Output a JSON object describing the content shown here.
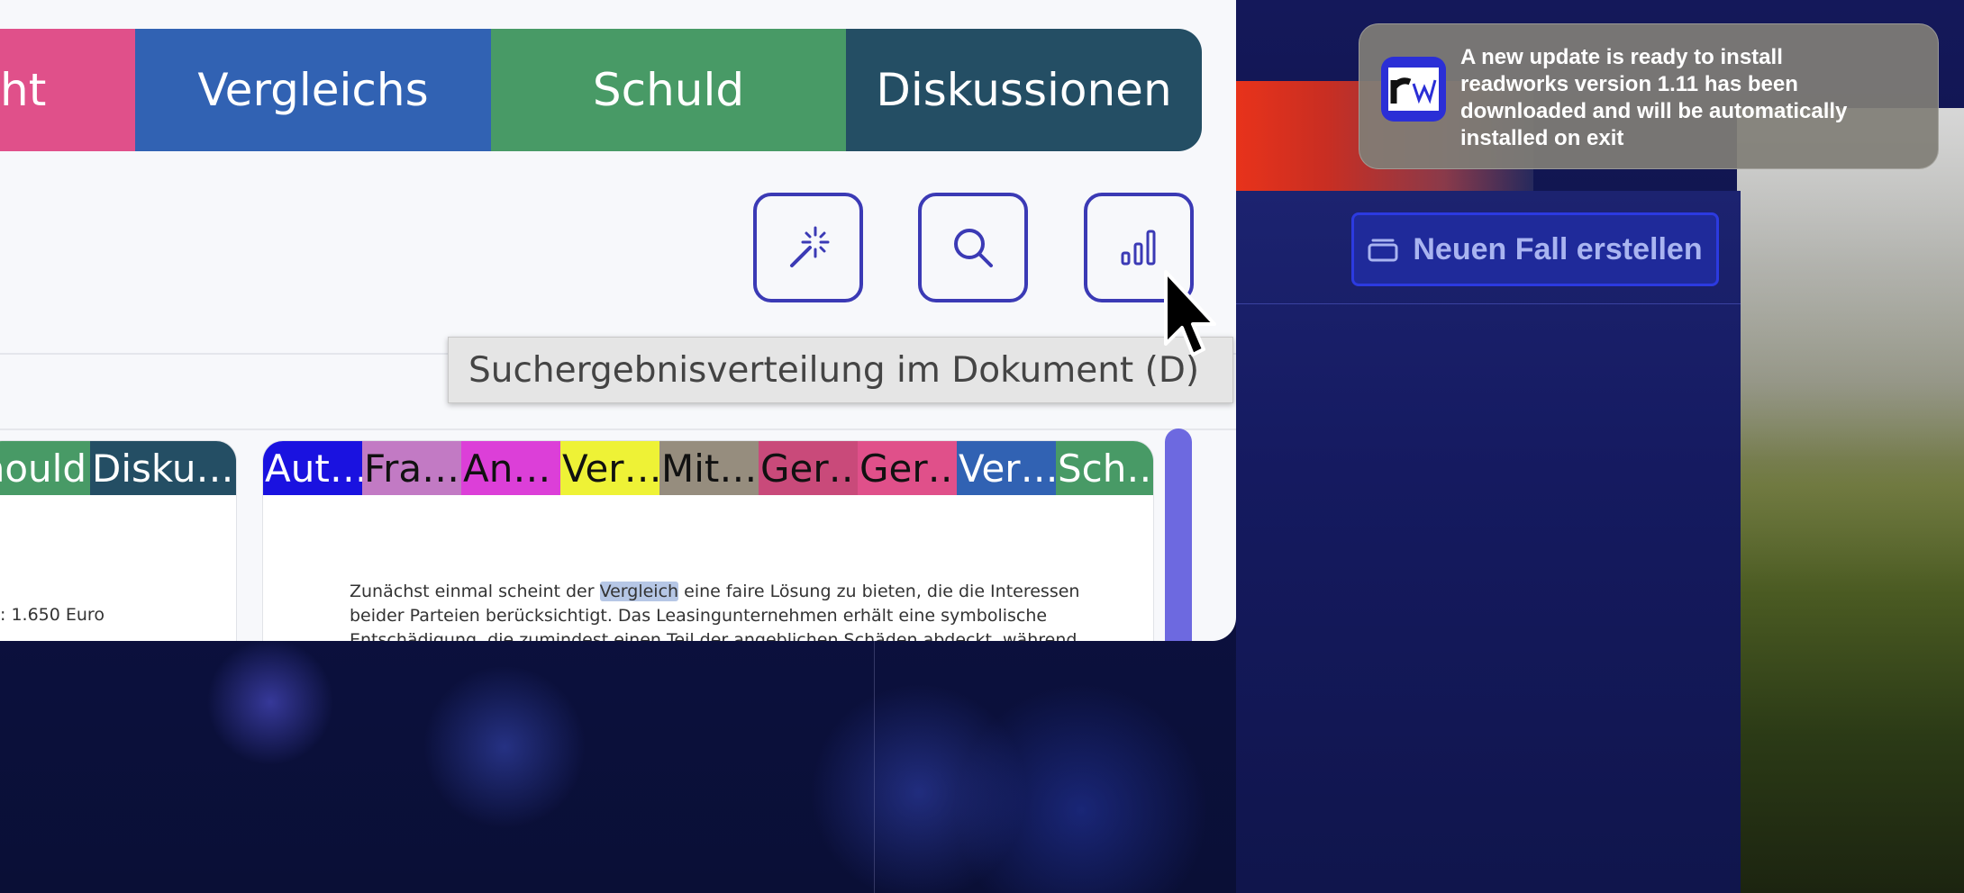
{
  "app": {
    "tabs": [
      {
        "label": "ht",
        "color": "#e0508a"
      },
      {
        "label": "Vergleichs",
        "color": "#3162b3"
      },
      {
        "label": "Schuld",
        "color": "#489a66"
      },
      {
        "label": "Diskussionen",
        "color": "#244e64"
      }
    ],
    "toolbar": {
      "buttons": [
        {
          "name": "magic-wand",
          "icon": "magic-wand-icon"
        },
        {
          "name": "search",
          "icon": "search-icon"
        },
        {
          "name": "distribution",
          "icon": "bar-chart-icon"
        }
      ],
      "tooltip": "Suchergebnisverteilung im Dokument (D)"
    },
    "left_card": {
      "chips": [
        {
          "label": "hould",
          "color": "#489a66"
        },
        {
          "label": "Disku…",
          "color": "#244e64"
        }
      ],
      "text": ": 1.650 Euro"
    },
    "right_card": {
      "chips": [
        {
          "label": "Aut…",
          "color": "#1a12e0",
          "text_color": "#ffffff"
        },
        {
          "label": "Fra…",
          "color": "#c27ac4",
          "text_color": "#111111"
        },
        {
          "label": "An…",
          "color": "#dc3fd8",
          "text_color": "#111111"
        },
        {
          "label": "Ver…",
          "color": "#eef236",
          "text_color": "#111111"
        },
        {
          "label": "Mit…",
          "color": "#968d7e",
          "text_color": "#111111"
        },
        {
          "label": "Ger…",
          "color": "#c94a7a",
          "text_color": "#111111"
        },
        {
          "label": "Ger…",
          "color": "#e0508a",
          "text_color": "#ffffff"
        },
        {
          "label": "Ver…",
          "color": "#3162b3",
          "text_color": "#ffffff"
        },
        {
          "label": "Sch…",
          "color": "#489a66",
          "text_color": "#ffffff"
        }
      ],
      "text_before": "Zunächst einmal scheint der ",
      "highlight": "Vergleich",
      "text_after": " eine faire Lösung zu bieten, die die Interessen beider Parteien berücksichtigt. Das Leasingunternehmen erhält eine symbolische Entschädigung, die zumindest einen Teil der angeblichen Schäden abdeckt, während"
    }
  },
  "background_app": {
    "new_case_label": "Neuen Fall erstellen"
  },
  "notification": {
    "line1": "A new update is ready to install",
    "line2": "readworks version 1.11 has been",
    "line3": "downloaded and will be automatically",
    "line4": "installed on exit",
    "app_icon": "readworks-logo-icon"
  }
}
